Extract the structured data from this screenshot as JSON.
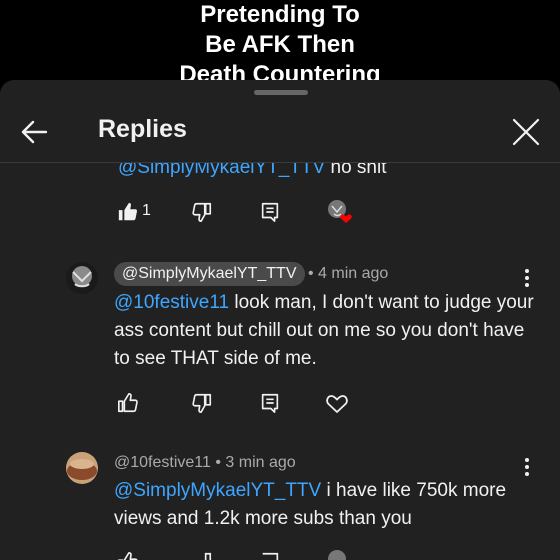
{
  "video": {
    "caption_lines": [
      "Pretending To",
      "Be AFK Then",
      "Death Countering"
    ]
  },
  "sheet": {
    "title": "Replies"
  },
  "replies": [
    {
      "mention": "@SimplyMykaelYT_TTV",
      "body": "no shit",
      "likes": "1"
    },
    {
      "author": "@SimplyMykaelYT_TTV",
      "time": "• 4 min ago",
      "mention": "@10festive11",
      "body": "look man, I don't want to judge your ass content but chill out on me so you don't have to see THAT side of me."
    },
    {
      "author": "@10festive11",
      "time": "• 3 min ago",
      "mention": "@SimplyMykaelYT_TTV",
      "body": "i have like 750k more views and 1.2k more subs than you"
    }
  ],
  "colors": {
    "mention": "#3ea6ff",
    "sheet_bg": "#212121",
    "heart": "#ff0000"
  },
  "icons": [
    "back-arrow-icon",
    "close-icon",
    "thumbs-up-icon",
    "thumbs-down-icon",
    "reply-icon",
    "creator-heart-icon",
    "more-vert-icon"
  ]
}
